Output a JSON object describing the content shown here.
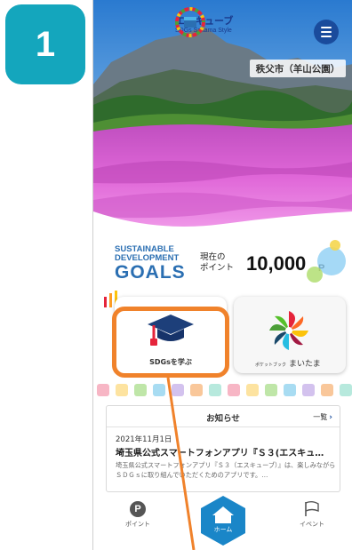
{
  "step_badge": {
    "number": "1"
  },
  "header": {
    "logo_title": "エスキューブ",
    "logo_subtitle": "SDGs Saitama Style",
    "location": "秩父市（羊山公園）"
  },
  "goals_panel": {
    "sdg_line1": "SUSTAINABLE",
    "sdg_line2": "DEVELOPMENT",
    "sdg_line3": "GOALS",
    "points_label_line1": "現在の",
    "points_label_line2": "ポイント",
    "points_value": "10,000",
    "points_unit": "P"
  },
  "tiles": {
    "learn_label": "SDGsを学ぶ",
    "maitama_small": "ポケットブック",
    "maitama_label": "まいたま"
  },
  "news": {
    "title": "お知らせ",
    "more_label": "一覧",
    "more_arrow": "›",
    "date": "2021年11月1日",
    "headline": "埼玉県公式スマートフォンアプリ『Ｓ３(エスキュ…",
    "body": "埼玉県公式スマートフォンアプリ『Ｓ３（エスキューブ）』は、楽しみながらＳＤＧｓに取り組んでいただくためのアプリです。…"
  },
  "tabbar": {
    "points_icon_letter": "P",
    "points_label": "ポイント",
    "home_label": "ホーム",
    "events_label": "イベント"
  },
  "colors": {
    "badge": "#14a6bd",
    "highlight": "#f0822b",
    "brand_blue": "#1a4b9c"
  },
  "icons": [
    "menu-icon",
    "graduation-cap-icon",
    "pinwheel-icon",
    "home-icon",
    "flag-icon",
    "points-icon",
    "chevron-right-icon"
  ]
}
